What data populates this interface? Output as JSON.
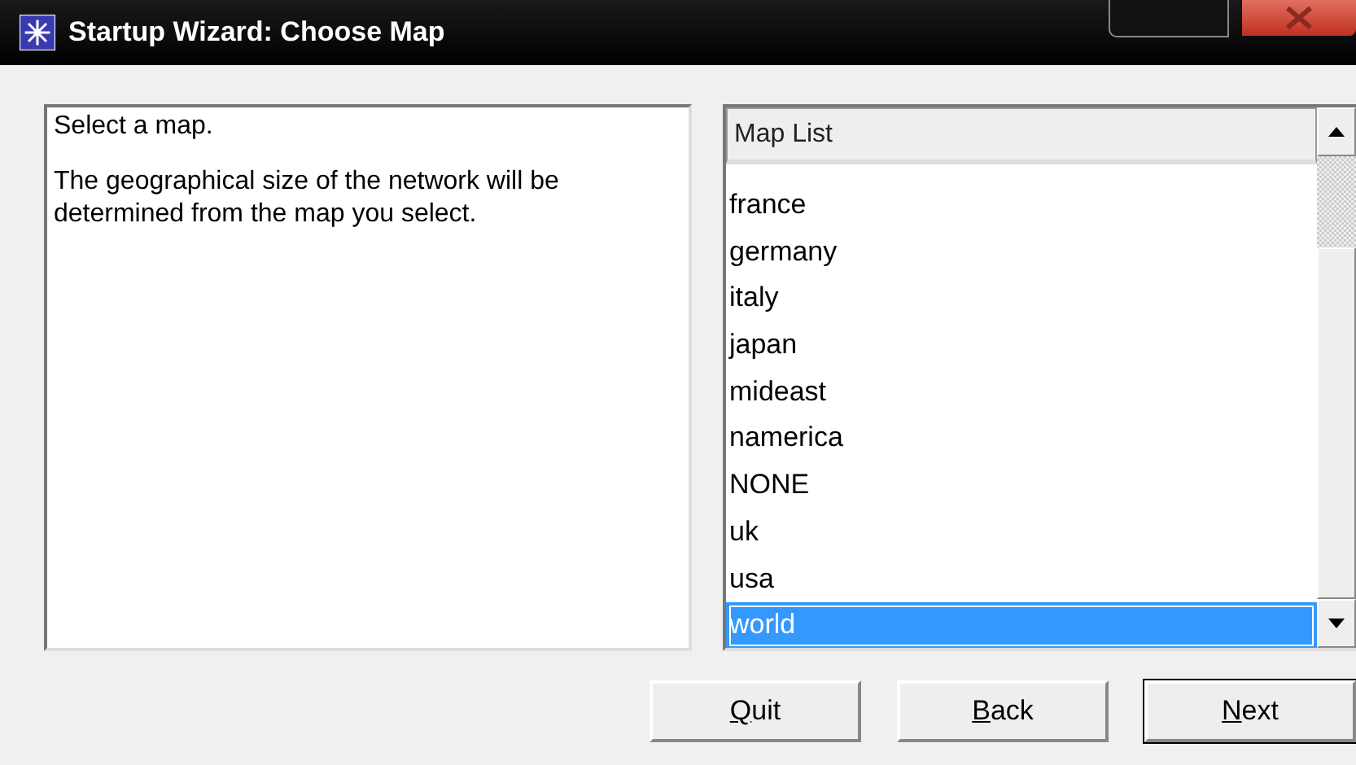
{
  "window": {
    "title": "Startup Wizard: Choose Map"
  },
  "description": [
    "Select a map.",
    "The geographical size of the network will be determined from the map you select."
  ],
  "map_list": {
    "header": "Map List",
    "items": [
      {
        "label": "france",
        "selected": false
      },
      {
        "label": "germany",
        "selected": false
      },
      {
        "label": "italy",
        "selected": false
      },
      {
        "label": "japan",
        "selected": false
      },
      {
        "label": "mideast",
        "selected": false
      },
      {
        "label": "namerica",
        "selected": false
      },
      {
        "label": "NONE",
        "selected": false
      },
      {
        "label": "uk",
        "selected": false
      },
      {
        "label": "usa",
        "selected": false
      },
      {
        "label": "world",
        "selected": true
      }
    ]
  },
  "buttons": [
    {
      "label": "Quit",
      "default": false
    },
    {
      "label": "Back",
      "default": false
    },
    {
      "label": "Next",
      "default": true
    }
  ]
}
